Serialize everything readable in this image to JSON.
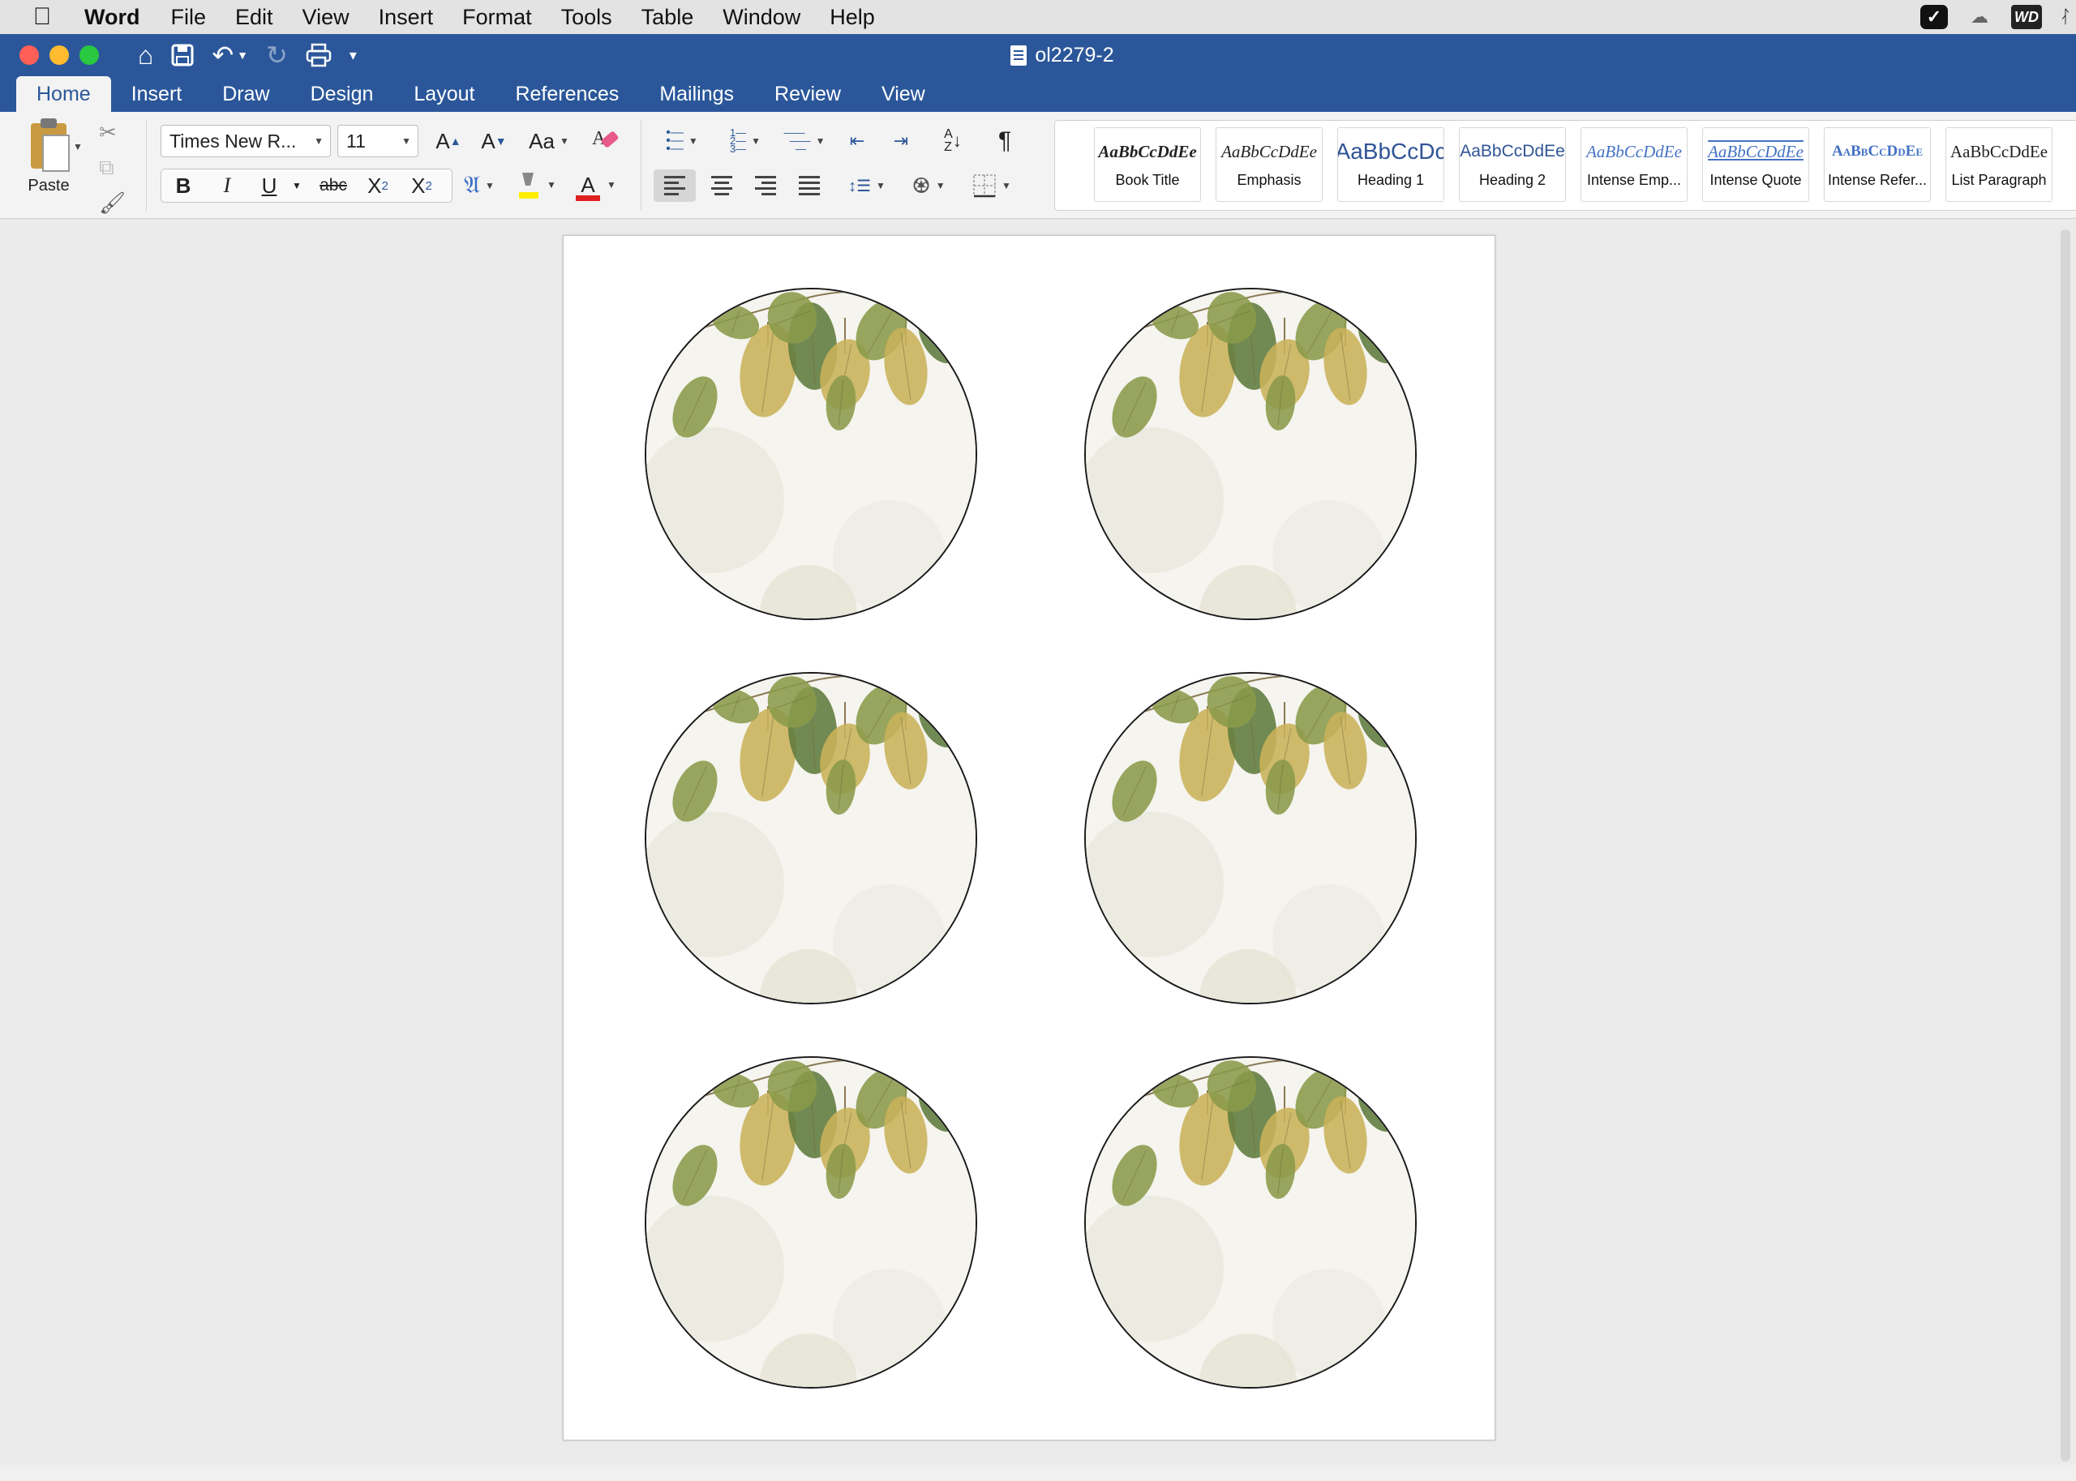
{
  "menubar": {
    "app_name": "Word",
    "items": [
      "File",
      "Edit",
      "View",
      "Insert",
      "Format",
      "Tools",
      "Table",
      "Window",
      "Help"
    ],
    "status_icons": [
      "checkmark-icon",
      "creative-cloud-icon",
      "wd-icon",
      "bluetooth-icon"
    ],
    "wd_label": "WD"
  },
  "titlebar": {
    "document_title": "ol2279-2",
    "traffic_colors": {
      "close": "#ff5f57",
      "minimize": "#febc2e",
      "zoom": "#28c840"
    }
  },
  "ribbon_tabs": [
    "Home",
    "Insert",
    "Draw",
    "Design",
    "Layout",
    "References",
    "Mailings",
    "Review",
    "View"
  ],
  "active_tab": "Home",
  "clipboard": {
    "paste_label": "Paste"
  },
  "font": {
    "family": "Times New R...",
    "size": "11"
  },
  "format_buttons": {
    "bold": "B",
    "italic": "I",
    "underline": "U",
    "strikethrough": "abc",
    "subscript": "X",
    "subscript_sub": "2",
    "superscript": "X",
    "superscript_sup": "2",
    "grow": "A",
    "shrink": "A",
    "change_case": "Aa",
    "font_color": "A"
  },
  "paragraph": {
    "show_marks": "¶"
  },
  "styles_gallery": [
    {
      "preview": "AaBbCcDdEe",
      "name": "Book Title"
    },
    {
      "preview": "AaBbCcDdEe",
      "name": "Emphasis"
    },
    {
      "preview": "AaBbCcDc",
      "name": "Heading 1"
    },
    {
      "preview": "AaBbCcDdEe",
      "name": "Heading 2"
    },
    {
      "preview": "AaBbCcDdEe",
      "name": "Intense Emp..."
    },
    {
      "preview": "AaBbCcDdEe",
      "name": "Intense Quote"
    },
    {
      "preview": "AaBbCcDdEe",
      "name": "Intense Refer..."
    },
    {
      "preview": "AaBbCcDdEe",
      "name": "List Paragraph"
    }
  ],
  "colors": {
    "accent": "#2b579a",
    "highlight": "#ffee00",
    "font_color_bar": "#e02020",
    "leaf_green": "#8a9a4a",
    "leaf_yellow": "#c9b25a",
    "leaf_dark": "#5f7a3c"
  },
  "document": {
    "label_count": 6,
    "label_shape": "circle",
    "label_art": "watercolor-leaves"
  }
}
